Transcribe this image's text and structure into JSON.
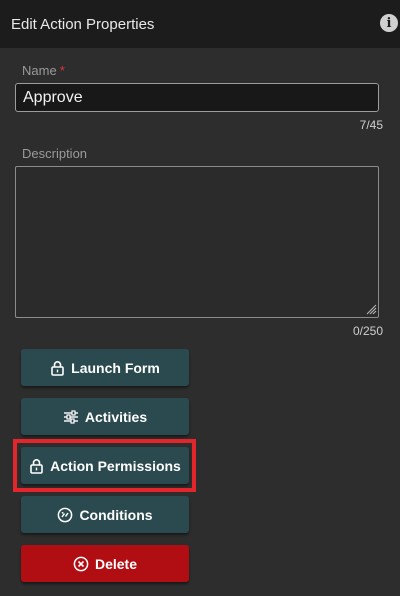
{
  "header": {
    "title": "Edit Action Properties",
    "info_icon": "info-icon"
  },
  "name_field": {
    "label": "Name",
    "required_mark": "*",
    "value": "Approve",
    "counter": "7/45"
  },
  "description_field": {
    "label": "Description",
    "value": "",
    "counter": "0/250"
  },
  "buttons": [
    {
      "label": "Launch Form",
      "icon": "lock-icon"
    },
    {
      "label": "Activities",
      "icon": "sliders-icon"
    },
    {
      "label": "Action Permissions",
      "icon": "lock-icon",
      "highlighted": true
    },
    {
      "label": "Conditions",
      "icon": "conditions-icon"
    },
    {
      "label": "Delete",
      "icon": "close-circle-icon"
    }
  ],
  "colors": {
    "header_bg": "#1c1c1c",
    "panel_bg": "#2d2d2d",
    "button_bg": "#2b4a4f",
    "delete_bg": "#b10e14",
    "highlight_border": "#e3262b",
    "required": "#e0343c"
  }
}
